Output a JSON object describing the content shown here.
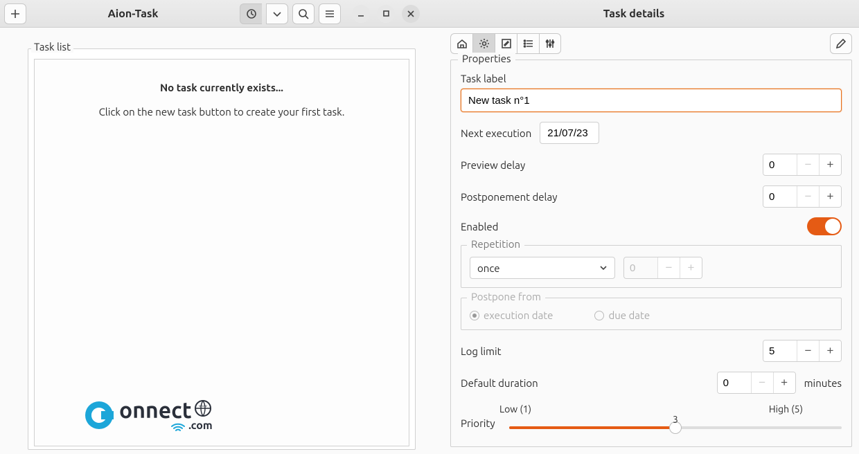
{
  "header": {
    "app_title": "Aion-Task",
    "details_title": "Task details"
  },
  "task_list": {
    "legend": "Task list",
    "empty_title": "No task currently exists...",
    "empty_hint": "Click on the new task button to create your first task."
  },
  "brand": {
    "name": "onnect",
    "suffix": "com"
  },
  "toolbar_icons": {
    "home": "home-icon",
    "gear": "gear-icon",
    "edit": "edit-icon",
    "list": "list-icon",
    "sliders": "sliders-icon",
    "pencil": "pencil-icon"
  },
  "properties": {
    "legend": "Properties",
    "task_label_caption": "Task label",
    "task_label_value": "New task n°1",
    "next_execution_caption": "Next execution",
    "next_execution_value": "21/07/23",
    "preview_delay_caption": "Preview delay",
    "preview_delay_value": "0",
    "postponement_delay_caption": "Postponement delay",
    "postponement_delay_value": "0",
    "enabled_caption": "Enabled",
    "enabled_value": true,
    "repetition": {
      "legend": "Repetition",
      "mode": "once",
      "count": "0"
    },
    "postpone_from": {
      "legend": "Postpone from",
      "option_execution": "execution date",
      "option_due": "due date",
      "selected": "execution"
    },
    "log_limit_caption": "Log limit",
    "log_limit_value": "5",
    "default_duration_caption": "Default duration",
    "default_duration_value": "0",
    "default_duration_unit": "minutes",
    "priority": {
      "caption": "Priority",
      "low_label": "Low (1)",
      "high_label": "High (5)",
      "value": "3",
      "min": 1,
      "max": 5
    }
  }
}
